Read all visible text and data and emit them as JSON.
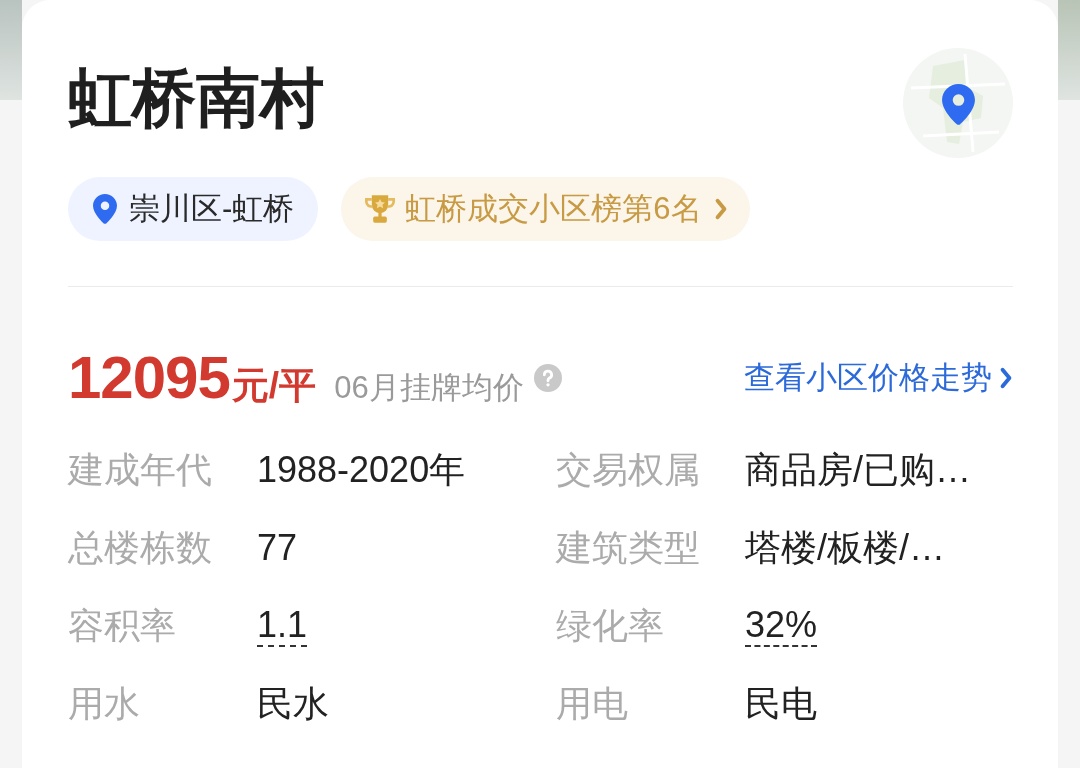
{
  "community": {
    "name": "虹桥南村"
  },
  "tags": [
    {
      "kind": "location",
      "label": "崇川区-虹桥"
    },
    {
      "kind": "ranking",
      "label": "虹桥成交小区榜第6名"
    }
  ],
  "price": {
    "value": "12095",
    "unit": "元/平",
    "caption": "06月挂牌均价",
    "trend_link": "查看小区价格走势"
  },
  "details": [
    {
      "label": "建成年代",
      "value": "1988-2020年",
      "underlined": false
    },
    {
      "label": "交易权属",
      "value": "商品房/已购…",
      "underlined": false
    },
    {
      "label": "总楼栋数",
      "value": "77",
      "underlined": false
    },
    {
      "label": "建筑类型",
      "value": "塔楼/板楼/…",
      "underlined": false
    },
    {
      "label": "容积率",
      "value": "1.1",
      "underlined": true
    },
    {
      "label": "绿化率",
      "value": "32%",
      "underlined": true
    },
    {
      "label": "用水",
      "value": "民水",
      "underlined": false
    },
    {
      "label": "用电",
      "value": "民电",
      "underlined": false
    }
  ]
}
